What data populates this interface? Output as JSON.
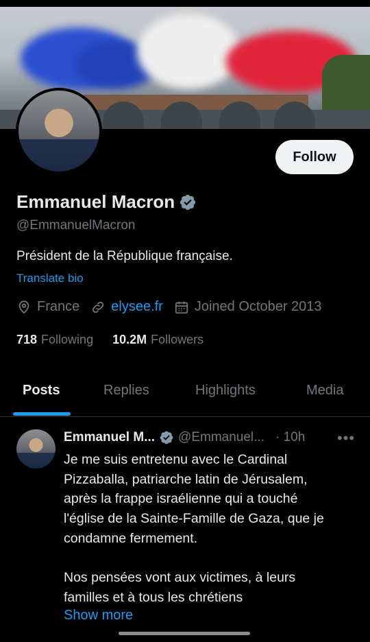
{
  "profile": {
    "name": "Emmanuel Macron",
    "handle": "@EmmanuelMacron",
    "bio": "Président de la République française.",
    "translate_label": "Translate bio",
    "location": "France",
    "website": "elysee.fr",
    "joined": "Joined October 2013",
    "following_count": "718",
    "following_label": "Following",
    "followers_count": "10.2M",
    "followers_label": "Followers",
    "follow_button": "Follow",
    "verified": true
  },
  "tabs": [
    {
      "label": "Posts",
      "active": true
    },
    {
      "label": "Replies",
      "active": false
    },
    {
      "label": "Highlights",
      "active": false
    },
    {
      "label": "Media",
      "active": false
    }
  ],
  "post": {
    "name": "Emmanuel M...",
    "handle": "@Emmanuel...",
    "time": "· 10h",
    "more": "•••",
    "text": "Je me suis entretenu avec le Cardinal\nPizzaballa, patriarche latin de Jérusalem,\naprès la frappe israélienne qui a touché\nl'église de la Sainte-Famille de Gaza, que je\ncondamne fermement.\n\nNos pensées vont aux victimes, à leurs\nfamilles et à tous les chrétiens",
    "show_more": "Show more"
  },
  "colors": {
    "background": "#000000",
    "accent": "#1d9bf0",
    "muted": "#71767b",
    "text": "#e7e9ea"
  },
  "icons": [
    "location-icon",
    "link-icon",
    "calendar-icon",
    "verified-badge-icon",
    "more-icon"
  ]
}
